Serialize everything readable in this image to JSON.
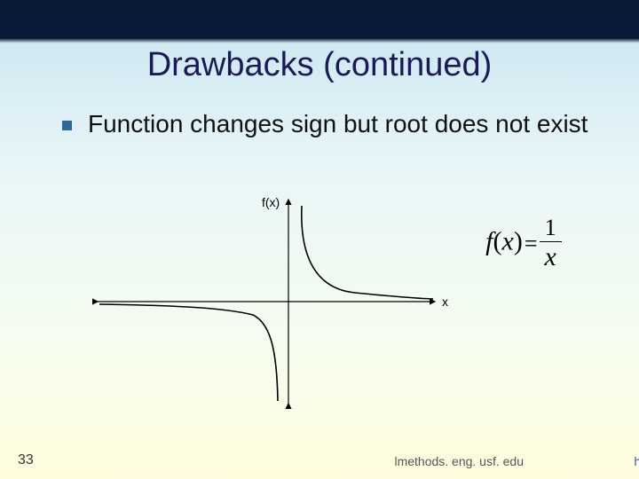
{
  "title": "Drawbacks (continued)",
  "bullet_text": "Function changes sign but root does not exist",
  "plot": {
    "y_axis_label": "f(x)",
    "x_axis_label": "x"
  },
  "equation": {
    "lhs": "f(x)",
    "numerator": "1",
    "denominator": "x"
  },
  "page_number": "33",
  "footer": "lmethods. eng. usf. edu",
  "edge_text": "ht"
}
